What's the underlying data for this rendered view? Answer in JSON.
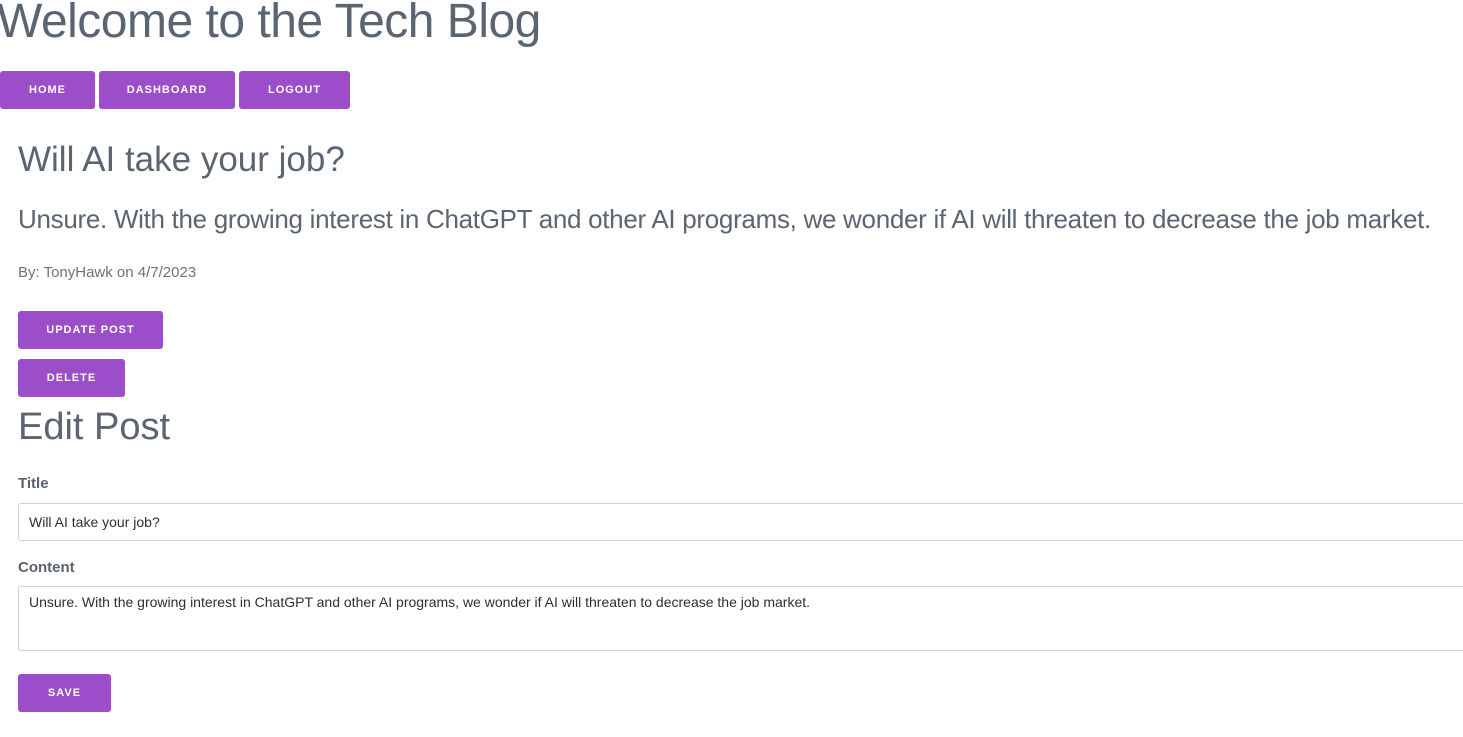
{
  "header": {
    "site_title": "Welcome to the Tech Blog"
  },
  "nav": {
    "home": "HOME",
    "dashboard": "DASHBOARD",
    "logout": "LOGOUT"
  },
  "post": {
    "title": "Will AI take your job?",
    "content": "Unsure. With the growing interest in ChatGPT and other AI programs, we wonder if AI will threaten to decrease the job market.",
    "byline": "By: TonyHawk on 4/7/2023",
    "update_label": "UPDATE POST",
    "delete_label": "DELETE"
  },
  "edit_form": {
    "heading": "Edit Post",
    "title_label": "Title",
    "title_value": "Will AI take your job?",
    "content_label": "Content",
    "content_value": "Unsure. With the growing interest in ChatGPT and other AI programs, we wonder if AI will threaten to decrease the job market.",
    "save_label": "SAVE"
  },
  "colors": {
    "accent": "#9b4dca",
    "text": "#5b6572"
  }
}
